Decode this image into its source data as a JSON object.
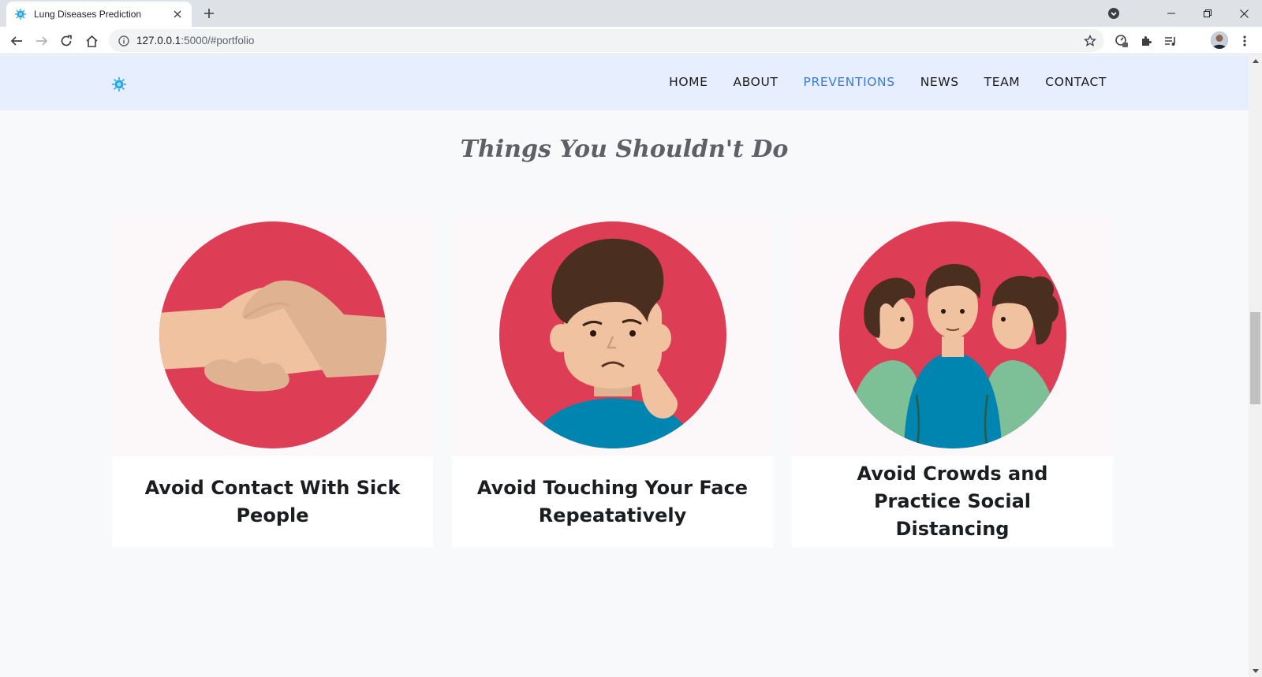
{
  "browser": {
    "tab_title": "Lung Diseases Prediction",
    "url_host": "127.0.0.1",
    "url_rest": ":5000/#portfolio"
  },
  "site": {
    "nav": [
      {
        "label": "HOME",
        "active": false
      },
      {
        "label": "ABOUT",
        "active": false
      },
      {
        "label": "PREVENTIONS",
        "active": true
      },
      {
        "label": "NEWS",
        "active": false
      },
      {
        "label": "TEAM",
        "active": false
      },
      {
        "label": "CONTACT",
        "active": false
      }
    ],
    "section_title": "Things You Shouldn't Do",
    "cards": [
      {
        "title": "Avoid Contact With Sick People",
        "image": "handshake-illustration"
      },
      {
        "title": "Avoid Touching Your Face Repeatatively",
        "image": "face-touching-illustration"
      },
      {
        "title": "Avoid Crowds and Practice Social Distancing",
        "image": "crowd-illustration"
      }
    ]
  },
  "colors": {
    "accent_nav": "#3b7bd8",
    "header_bg": "#e7eefe",
    "circle_red": "#dd3d55",
    "shirt_blue": "#0085b0"
  }
}
